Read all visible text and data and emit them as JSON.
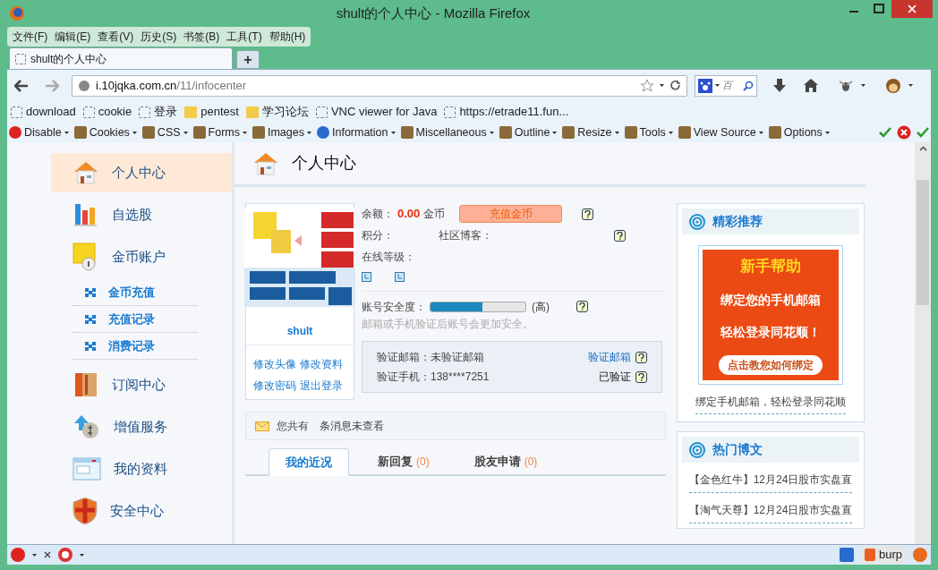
{
  "window": {
    "title": "shult的个人中心 - Mozilla Firefox"
  },
  "menu_bar": [
    "文件(F)",
    "编辑(E)",
    "查看(V)",
    "历史(S)",
    "书签(B)",
    "工具(T)",
    "帮助(H)"
  ],
  "tabs": [
    {
      "label": "shult的个人中心",
      "selected": true
    }
  ],
  "new_tab": "+",
  "address": {
    "host": "i.10jqka.com.cn",
    "path": "/11/infocenter"
  },
  "search": {
    "placeholder": "百"
  },
  "bookmarks": [
    {
      "label": "download",
      "kind": "page"
    },
    {
      "label": "cookie",
      "kind": "page"
    },
    {
      "label": "登录",
      "kind": "page"
    },
    {
      "label": "pentest",
      "kind": "folder"
    },
    {
      "label": "学习论坛",
      "kind": "folder"
    },
    {
      "label": "VNC viewer for Java",
      "kind": "page"
    },
    {
      "label": "https://etrade11.fun...",
      "kind": "page"
    }
  ],
  "dev_toolbar": [
    "Disable",
    "Cookies",
    "CSS",
    "Forms",
    "Images",
    "Information",
    "Miscellaneous",
    "Outline",
    "Resize",
    "Tools",
    "View Source",
    "Options"
  ],
  "sidebar": {
    "items": [
      {
        "label": "个人中心",
        "selected": true
      },
      {
        "label": "自选股",
        "selected": false
      },
      {
        "label": "金币账户",
        "selected": false,
        "children": [
          {
            "label": "金币充值",
            "selected": false
          },
          {
            "label": "充值记录",
            "selected": false
          },
          {
            "label": "消费记录",
            "selected": false
          }
        ]
      },
      {
        "label": "订阅中心",
        "selected": false
      },
      {
        "label": "增值服务",
        "selected": false
      },
      {
        "label": "我的资料",
        "selected": false
      },
      {
        "label": "安全中心",
        "selected": false
      }
    ]
  },
  "page": {
    "title": "个人中心"
  },
  "profile": {
    "username": "shult",
    "links": [
      "修改头像",
      "修改资料",
      "修改密码",
      "退出登录"
    ]
  },
  "account": {
    "balance_label": "余额：",
    "balance": "0.00",
    "balance_unit": "金币",
    "recharge_button": "充值金币",
    "points_label": "积分：",
    "blog_label": "社区博客：",
    "level_label": "在线等级：",
    "security_label": "账号安全度：",
    "security": {
      "level": 0.55,
      "reading": "(高)"
    },
    "hint": "邮箱或手机验证后账号会更加安全。",
    "verify": [
      {
        "label": "验证邮箱：",
        "value": "未验证邮箱",
        "action": "验证邮箱",
        "kind": "link"
      },
      {
        "label": "验证手机：",
        "value": "138****7251",
        "action": "已验证",
        "kind": "done"
      }
    ]
  },
  "messages": {
    "before": "您共有",
    "after": "条消息未查看"
  },
  "feed_tabs": [
    {
      "label": "我的近况",
      "selected": true
    },
    {
      "label": "新回复",
      "count": "(0)",
      "selected": false
    },
    {
      "label": "股友申请",
      "count": "(0)",
      "selected": false
    }
  ],
  "recommend": {
    "title": "精彩推荐",
    "banner": {
      "headline": "新手帮助",
      "line1": "绑定您的手机邮箱",
      "line2": "轻松登录同花顺！",
      "button": "点击教您如何绑定"
    },
    "caption": "绑定手机邮箱，轻松登录同花顺"
  },
  "hot_posts": {
    "title": "热门博文",
    "items": [
      "【金色红牛】12月24日股市实盘直",
      "【淘气天尊】12月24日股市实盘直"
    ]
  },
  "status_bar": {
    "burp": "burp"
  }
}
